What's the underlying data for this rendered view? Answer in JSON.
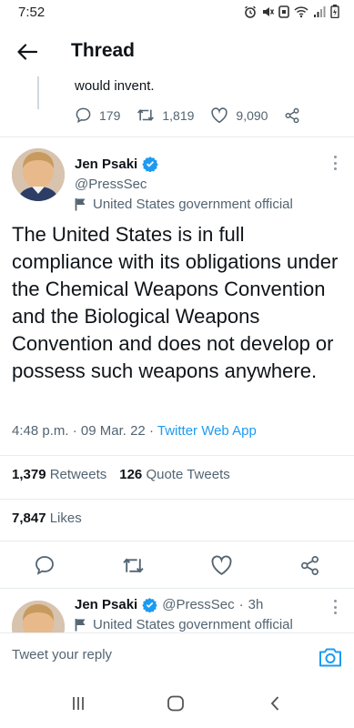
{
  "status_bar": {
    "time": "7:52"
  },
  "header": {
    "title": "Thread"
  },
  "previous_tweet": {
    "text_fragment": "would invent.",
    "replies": "179",
    "retweets": "1,819",
    "likes": "9,090"
  },
  "main_tweet": {
    "author_name": "Jen Psaki",
    "handle": "@PressSec",
    "label": "United States government official",
    "text": "The United States is in full compliance with its obligations under the Chemical Weapons Convention and the Biological Weapons Convention and does not develop or possess such weapons anywhere.",
    "time": "4:48 p.m.",
    "date": "09 Mar. 22",
    "app": "Twitter Web App",
    "separator": "·",
    "retweets_count": "1,379",
    "retweets_label": "Retweets",
    "quotes_count": "126",
    "quotes_label": "Quote Tweets",
    "likes_count": "7,847",
    "likes_label": "Likes"
  },
  "reply_preview": {
    "author_name": "Jen Psaki",
    "handle": "@PressSec",
    "time_ago": "3h",
    "separator": "·",
    "label": "United States government official"
  },
  "composer": {
    "placeholder": "Tweet your reply"
  },
  "colors": {
    "accent": "#1d9bf0",
    "text": "#0f1419",
    "secondary": "#536471"
  },
  "icons": {
    "back": "arrow-left-icon",
    "reply": "reply-icon",
    "retweet": "retweet-icon",
    "like": "heart-icon",
    "share": "share-icon",
    "verified": "verified-badge-icon",
    "flag": "flag-icon",
    "camera": "camera-icon"
  }
}
